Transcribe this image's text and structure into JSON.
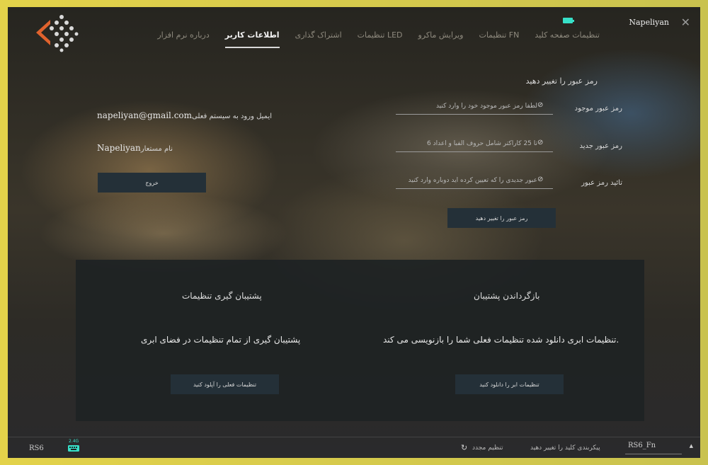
{
  "brand": "Napeliyan",
  "nav": {
    "tabs": [
      {
        "label": "درباره نرم افزار",
        "active": false
      },
      {
        "label": "اطلاعات کاربر",
        "active": true
      },
      {
        "label": "اشتراک گذاری",
        "active": false
      },
      {
        "label": "LED تنظیمات",
        "active": false
      },
      {
        "label": "ویرایش ماکرو",
        "active": false
      },
      {
        "label": "FN تنظیمات",
        "active": false
      },
      {
        "label": "تنظیمات صفحه کلید",
        "active": false
      }
    ]
  },
  "password": {
    "title": "رمز عبور را تغییر دهید",
    "current_label": "رمز عبور موجود",
    "current_placeholder": "لطفا رمز عبور موجود خود را وارد کنید",
    "new_label": "رمز عبور جدید",
    "new_placeholder": "تا 25 کاراکتر شامل حروف الفبا و اعداد 6",
    "confirm_label": "تائید رمز عبور",
    "confirm_placeholder": "عبور جدیدی را که تعیین کرده اید دوباره وارد کنید",
    "submit_label": "رمز عبور را تغییر دهید"
  },
  "account": {
    "email_label": "ایمیل ورود به سیستم فعلی",
    "email_value": "napeliyan@gmail.com",
    "username_label": "نام مستعار",
    "username_value": "Napeliyan",
    "logout_label": "خروج"
  },
  "backup": {
    "title": "پشتیبان گیری تنظیمات",
    "description": "پشتیبان گیری از تمام تنظیمات در فضای ابری",
    "button_label": "تنظیمات فعلی را آپلود کنید"
  },
  "restore": {
    "title": "بازگرداندن پشتیبان",
    "description": ".تنظیمات ابری دانلود شده تنظیمات فعلی شما را بازنویسی می کند",
    "button_label": "تنظیمات ابر را دانلود کنید"
  },
  "footer": {
    "device_name": "RS6",
    "keyboard_badge": "2.4G",
    "reset_label": "تنظیم مجدد",
    "change_layout_label": "پیکربندی کلید را تغییر دهید",
    "profile_value": "RS6_Fn"
  },
  "colors": {
    "frame": "#e3d24a",
    "button": "#243038",
    "accent_battery": "#37e0c8",
    "logo_orange": "#e0622d"
  },
  "icons": {
    "logo": "dot-diamond-logo",
    "battery": "battery-icon",
    "close": "close-icon",
    "eye": "eye-off-icon",
    "reset": "refresh-icon",
    "keyboard": "keyboard-icon",
    "dropdown": "caret-down-icon"
  }
}
